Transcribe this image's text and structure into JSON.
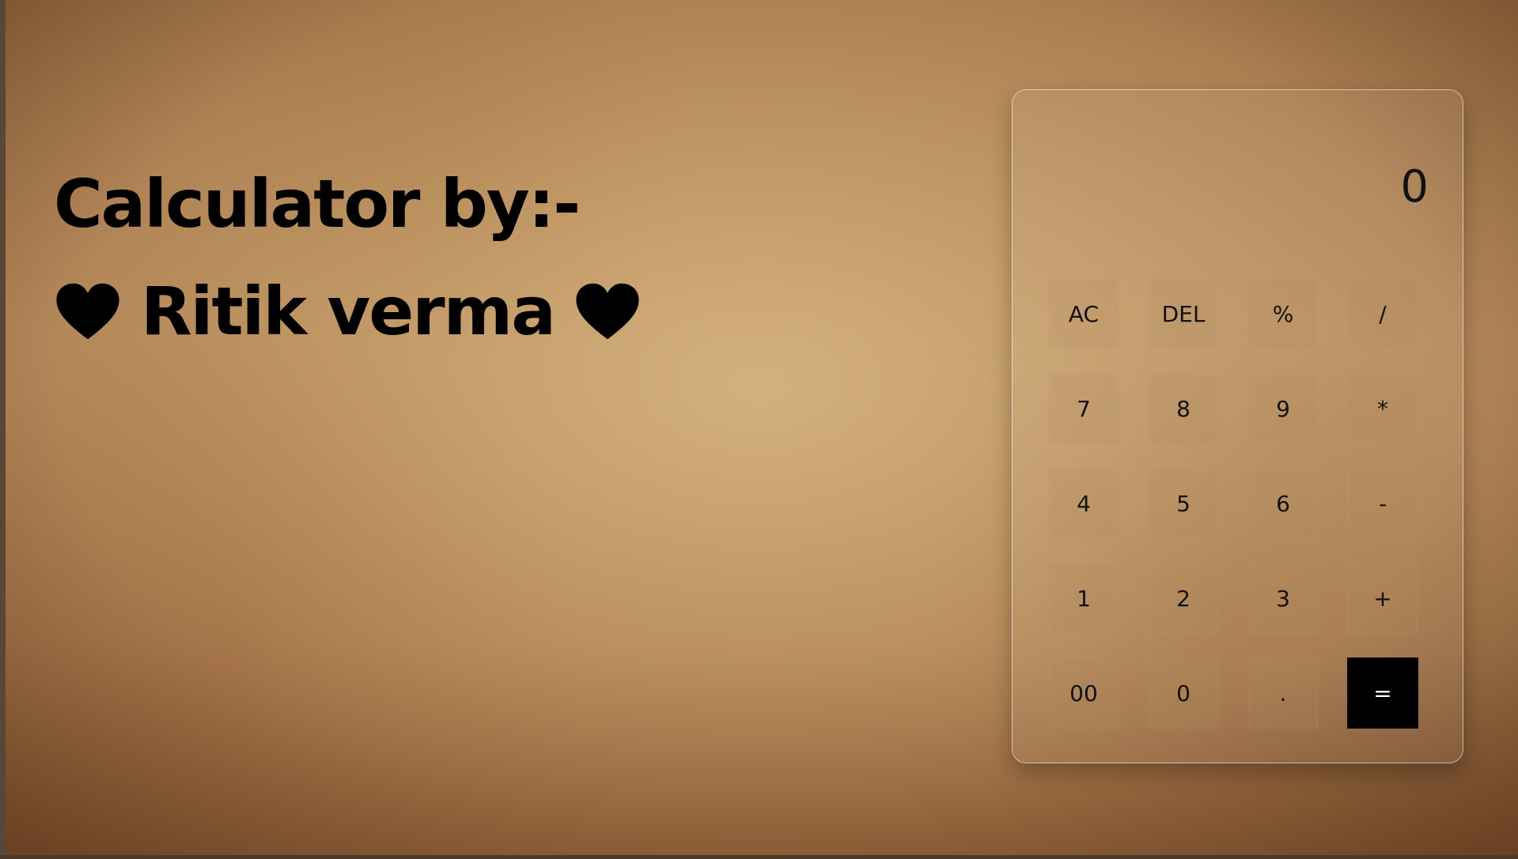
{
  "colors": {
    "text": "#000000",
    "equals_bg": "#000000",
    "equals_text": "#ffffff"
  },
  "heading": {
    "line1": "Calculator by:-",
    "name": "Ritik verma",
    "left_icon": "heart-icon",
    "right_icon": "heart-icon"
  },
  "calculator": {
    "display_value": "0",
    "keys": [
      {
        "label": "AC"
      },
      {
        "label": "DEL"
      },
      {
        "label": "%"
      },
      {
        "label": "/"
      },
      {
        "label": "7"
      },
      {
        "label": "8"
      },
      {
        "label": "9"
      },
      {
        "label": "*"
      },
      {
        "label": "4"
      },
      {
        "label": "5"
      },
      {
        "label": "6"
      },
      {
        "label": "-"
      },
      {
        "label": "1"
      },
      {
        "label": "2"
      },
      {
        "label": "3"
      },
      {
        "label": "+"
      },
      {
        "label": "00"
      },
      {
        "label": "0"
      },
      {
        "label": "."
      },
      {
        "label": "="
      }
    ]
  }
}
